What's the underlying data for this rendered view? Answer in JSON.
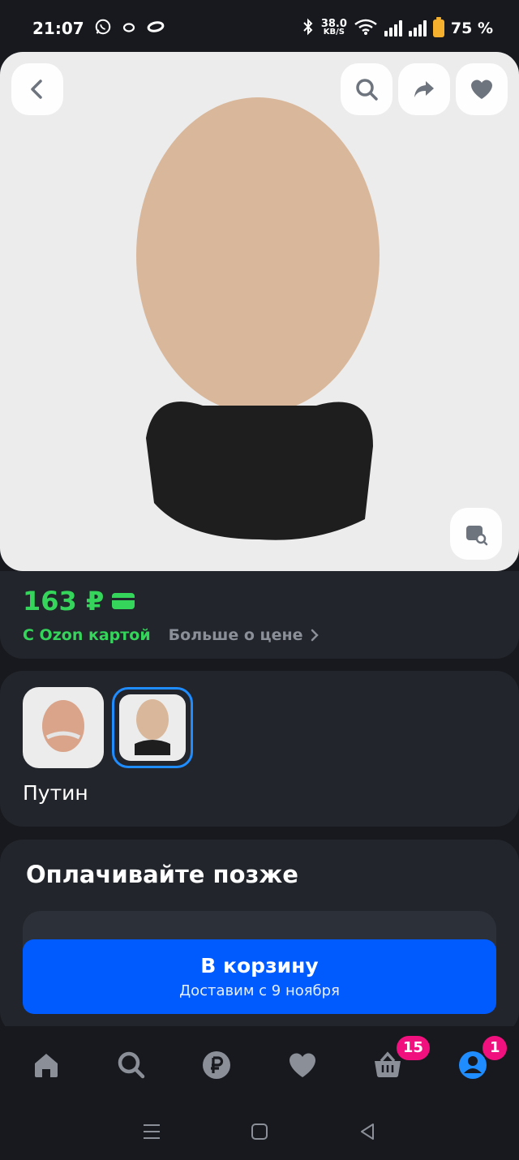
{
  "status_bar": {
    "time": "21:07",
    "speed_value": "38.0",
    "speed_unit": "KB/S",
    "battery": "75 %",
    "icons": [
      "whatsapp-icon",
      "notification-ring-icon",
      "notification-oval-icon",
      "bluetooth-icon",
      "wifi-icon",
      "signal-icon",
      "battery-icon"
    ]
  },
  "hero": {
    "actions": [
      "back-icon",
      "search-icon",
      "share-icon",
      "heart-icon"
    ],
    "corner_action": "image-search-icon"
  },
  "price": {
    "value": "163 ₽",
    "ozon_card_label": "С Ozon картой",
    "more_label": "Больше о цене",
    "accent_color": "#35d55c"
  },
  "variants": {
    "selected_name": "Путин",
    "selected_index": 1,
    "count": 2
  },
  "pay_later": {
    "title": "Оплачивайте позже"
  },
  "cart_button": {
    "label": "В корзину",
    "delivery": "Доставим с 9 ноября",
    "color": "#005bff"
  },
  "bottom_nav": {
    "items": [
      "home-icon",
      "search-icon",
      "ruble-icon",
      "heart-icon",
      "cart-icon",
      "profile-icon"
    ],
    "cart_badge": "15",
    "profile_badge": "1",
    "badge_color": "#f1117e"
  }
}
